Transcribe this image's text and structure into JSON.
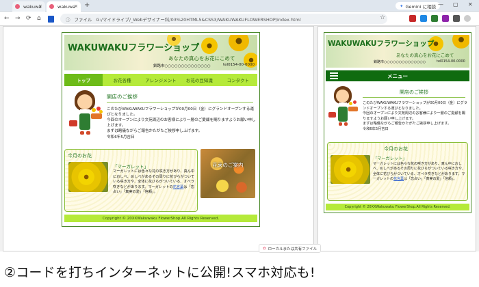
{
  "browser": {
    "tabs": [
      {
        "label": "wakuwa"
      },
      {
        "label": "wakuwa"
      }
    ],
    "new_tab": "+",
    "gemini_label": "Gemini に相談",
    "nav": {
      "back": "←",
      "forward": "→",
      "reload": "⟳",
      "home": "⌂"
    },
    "url_prefix": "ファイル",
    "url": "G:/マイドライブ/_Webデザイナー科/03%20HTML5&CSS3/WAKUWAKUFLOWERSHOP/index.html",
    "download_text": "ローカルまたは共有ファイル",
    "win_min": "—",
    "win_max": "▢",
    "win_close": "✕"
  },
  "site": {
    "logo": "WAKUWAKUフラワーショップ",
    "tagline": "あなたの真心をお花にこめて",
    "address": "釧路市○○○○○○○○○○○○○○",
    "tel": "tel0154-00-0000",
    "menu": [
      "トップ",
      "お花各種",
      "アレンジメント",
      "お花の豆知識",
      "コンタクト"
    ],
    "mobile_menu": "メニュー",
    "greeting_title": "開店のご挨拶",
    "greeting_lines": [
      "このたびWAKUWAKUフラワーショップが00月00日（金）にグランドオープンする運びとなりました。",
      "今回のオープンにより文苑周辺のお客様により一層のご愛顧を賜りますようお願い申し上げます。",
      "まずは略儀ながらご報告かたがたご挨拶申し上げます。",
      "令和6年5月吉日"
    ],
    "month_flower_title": "今月のお花",
    "marguerite_title": "「マーガレット」",
    "marguerite_text_a": "マーガレットには色々な花の咲き方があり、真ん中におしべ、めしべがあるその周りに花びらがついている咲き方や、全体に花びらがついている、オペラ咲きなどがあります。マーガレットの",
    "marguerite_link": "花言葉",
    "marguerite_text_b": "は「恋占い」「真実の愛」「信頼」。",
    "photo_caption": "花束のご案内",
    "footer": "Copyright © 20XXWakuwaku FlowerShop.All Rights Reserved."
  },
  "caption": "②コードを打ちインターネットに公開!スマホ対応も!"
}
